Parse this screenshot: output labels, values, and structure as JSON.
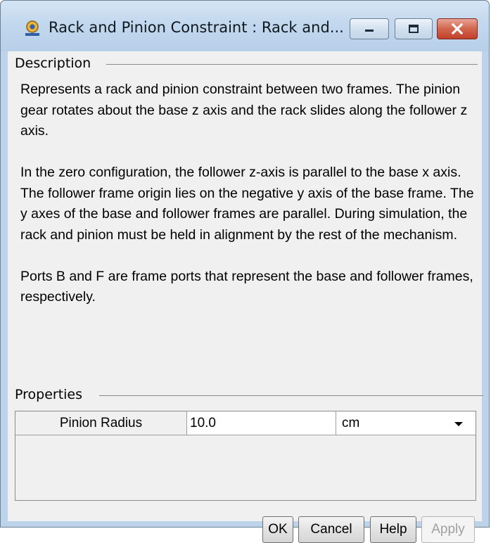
{
  "window": {
    "title": "Rack and Pinion Constraint : Rack and...",
    "controls": [
      "minimize-icon",
      "maximize-icon",
      "close-icon"
    ],
    "accent_close": "#c9452e"
  },
  "description": {
    "label": "Description",
    "paragraphs": [
      "Represents a rack and pinion constraint between two frames. The pinion gear rotates about the base z axis and the rack slides along the follower z axis.",
      "In the zero configuration, the follower z-axis is parallel to the base x axis. The follower frame origin lies on the negative y axis of the base frame. The y axes of the base and follower frames are parallel. During simulation, the rack and pinion must be held in alignment by the rest of the mechanism.",
      "Ports B and F are frame ports that represent the base and follower frames, respectively."
    ]
  },
  "properties": {
    "label": "Properties",
    "rows": [
      {
        "name": "Pinion Radius",
        "value": "10.0",
        "unit": "cm"
      }
    ]
  },
  "buttons": {
    "ok": "OK",
    "cancel": "Cancel",
    "help": "Help",
    "apply": "Apply"
  }
}
